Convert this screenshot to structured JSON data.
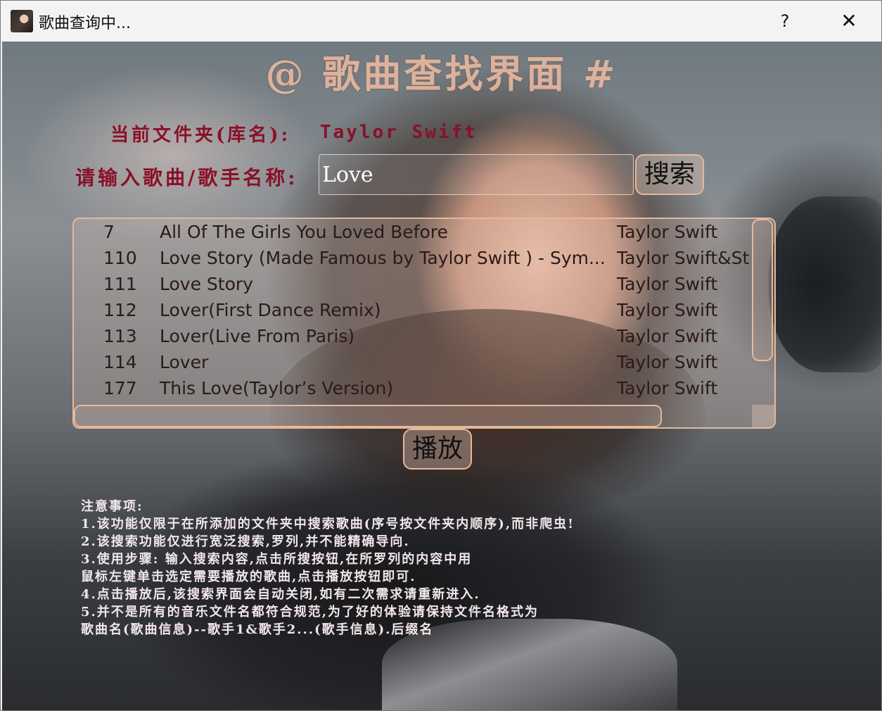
{
  "window": {
    "title": "歌曲查询中...",
    "help_label": "?",
    "close_label": "✕"
  },
  "header": {
    "title": "@ 歌曲查找界面 #"
  },
  "folder": {
    "label": "当前文件夹(库名):",
    "value": "Taylor Swift"
  },
  "search": {
    "label": "请输入歌曲/歌手名称:",
    "value": "Love",
    "button_label": "搜索"
  },
  "results": {
    "rows": [
      {
        "no": "7",
        "title": "All Of The Girls You Loved Before",
        "artist": "Taylor Swift"
      },
      {
        "no": "110",
        "title": "Love Story (Made Famous by Taylor Swift ) - Sym...",
        "artist": "Taylor Swift&St"
      },
      {
        "no": "111",
        "title": "Love Story",
        "artist": "Taylor Swift"
      },
      {
        "no": "112",
        "title": "Lover(First Dance Remix)",
        "artist": "Taylor Swift"
      },
      {
        "no": "113",
        "title": "Lover(Live From Paris)",
        "artist": "Taylor Swift"
      },
      {
        "no": "114",
        "title": "Lover",
        "artist": "Taylor Swift"
      },
      {
        "no": "177",
        "title": "This Love(Taylor’s Version)",
        "artist": "Taylor Swift"
      }
    ]
  },
  "actions": {
    "play_label": "播放"
  },
  "notes": {
    "lines": [
      "注意事项:",
      "1.该功能仅限于在所添加的文件夹中搜索歌曲(序号按文件夹内顺序),而非爬虫!",
      "2.该搜索功能仅进行宽泛搜索,罗列,并不能精确导向.",
      "3.使用步骤: 输入搜索内容,点击所搜按钮,在所罗列的内容中用",
      "鼠标左键单击选定需要播放的歌曲,点击播放按钮即可.",
      "4.点击播放后,该搜索界面会自动关闭,如有二次需求请重新进入.",
      "5.并不是所有的音乐文件名都符合规范,为了好的体验请保持文件名格式为",
      "歌曲名(歌曲信息)--歌手1&歌手2...(歌手信息).后缀名"
    ]
  },
  "colors": {
    "accent_label": "#8a1028",
    "border_accent": "#e6b89a",
    "title_color": "#e8b8a0",
    "notes_color": "#f2e6ea"
  }
}
